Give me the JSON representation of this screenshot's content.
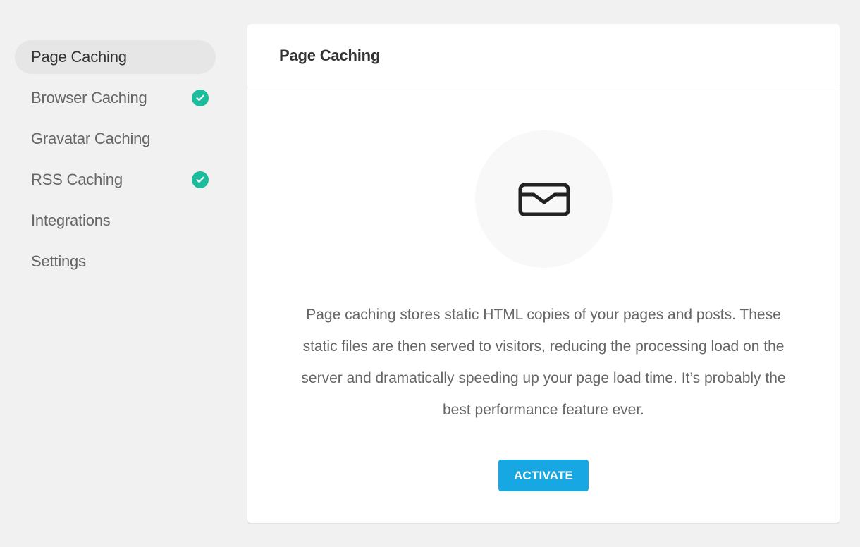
{
  "sidebar": {
    "items": [
      {
        "label": "Page Caching",
        "active": true,
        "checked": false
      },
      {
        "label": "Browser Caching",
        "active": false,
        "checked": true
      },
      {
        "label": "Gravatar Caching",
        "active": false,
        "checked": false
      },
      {
        "label": "RSS Caching",
        "active": false,
        "checked": true
      },
      {
        "label": "Integrations",
        "active": false,
        "checked": false
      },
      {
        "label": "Settings",
        "active": false,
        "checked": false
      }
    ],
    "check_icon": "check-circle-icon",
    "check_color": "#1abc9c"
  },
  "panel": {
    "title": "Page Caching",
    "hero_icon": "inbox-tray-icon",
    "description": "Page caching stores static HTML copies of your pages and posts. These static files are then served to visitors, reducing the processing load on the server and dramatically speeding up your page load time. It’s probably the best performance feature ever.",
    "activate_label": "ACTIVATE",
    "accent_color": "#17a8e3"
  }
}
